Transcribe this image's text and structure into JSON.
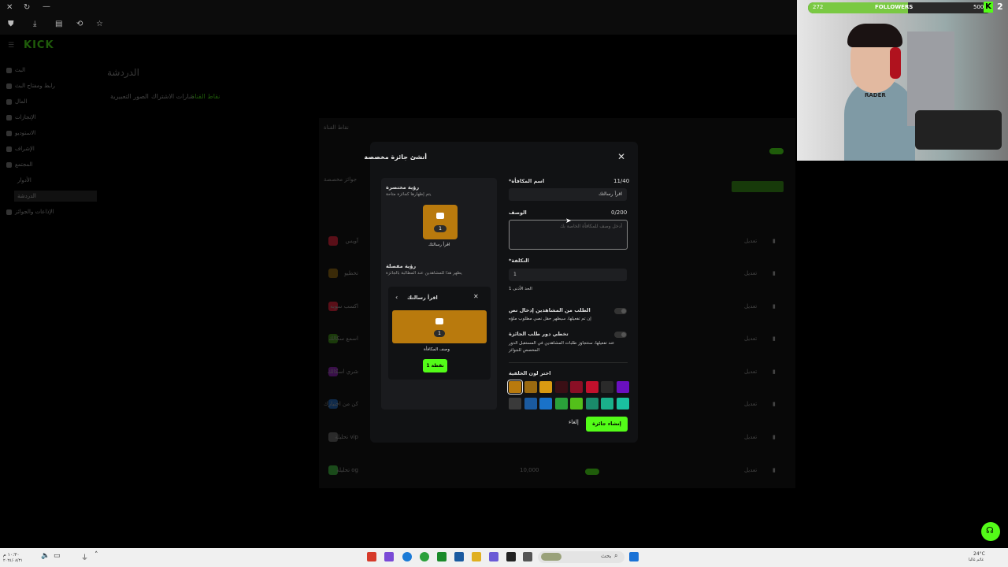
{
  "browser": {
    "nav_icons": [
      "close-icon",
      "reload-icon",
      "minimize-icon"
    ],
    "toolbar_icons": [
      "shield-icon",
      "download-icon",
      "sidebar-icon",
      "translate-icon",
      "star-icon"
    ]
  },
  "site": {
    "logo": "KICK",
    "logo_color": "#53fc18"
  },
  "sidebar": {
    "items": [
      {
        "label": "البث"
      },
      {
        "label": "رابط ومفتاح البث"
      },
      {
        "label": "المال"
      },
      {
        "label": "الإنجازات"
      },
      {
        "label": "الاستوديو"
      },
      {
        "label": "الإشراف"
      },
      {
        "label": "المجتمع"
      },
      {
        "label": "الأدوار"
      },
      {
        "label": "الدردشة"
      },
      {
        "label": "الإذاعات والجوائز"
      }
    ]
  },
  "main": {
    "title": "الدردشة",
    "tabs": [
      "نقاط القناة",
      "شارات الاشتراك",
      "الصور التعبيرية"
    ],
    "bg_section_title": "نقاط القناة",
    "bg_custom_title": "جوائز مخصصة",
    "bg_rows": [
      {
        "name": "آويس",
        "edit": "تعديل"
      },
      {
        "name": "تخطيو",
        "edit": "تعديل"
      },
      {
        "name": "اكسب سوبه",
        "edit": "تعديل"
      },
      {
        "name": "اسمع سكالك",
        "edit": "تعديل"
      },
      {
        "name": "شري اسكالك",
        "edit": "تعديل"
      },
      {
        "name": "كن من اختيارك",
        "edit": "تعديل"
      },
      {
        "name": "تحليلة vip",
        "edit": "تعديل"
      },
      {
        "name": "تحليلة og",
        "edit": "تعديل",
        "value": "10,000"
      }
    ]
  },
  "modal": {
    "title": "أنشئ جائزة مخصصة",
    "close": "✕",
    "preview_short_title": "رؤية مختصرة",
    "preview_short_sub": "يتم إظهارها كجائزة متاحة",
    "reward_count": "1",
    "reward_name": "اقرأ رسالتك",
    "preview_full_title": "رؤية مفصلة",
    "preview_full_sub": "يظهر هذا للمشاهدين عند المطالبة بالجائزة",
    "card_title": "اقرأ رسالتك",
    "card_desc": "وصف المكافأة",
    "redeem_label": "1 نقطة",
    "name_label": "*اسم المكافأة",
    "name_count": "11/40",
    "name_value": "اقرأ رسالتك",
    "desc_label": "الوصف",
    "desc_count": "0/200",
    "desc_placeholder": "أدخل وصف للمكافأة الخاصة بك",
    "cost_label": "*التكلفة",
    "cost_value": "1",
    "cost_min": "الحد الأدنى 1",
    "req_input_title": "الطلب من المشاهدين إدخال نص",
    "req_input_sub": "إن تم تفعيلها، سيظهر حقل نصي مطلوب ملؤه",
    "skip_queue_title": "تخطي دور طلب الجائزة",
    "skip_queue_sub": "عند تفعيلها، ستتجاوز طلبات المشاهدين في المستقبل الدور المخصص للجوائز",
    "color_label": "اختر لون الخلفية",
    "colors_row1": [
      "#b97a0d",
      "#9b6a10",
      "#d99a12",
      "#3a0f15",
      "#8a0f25",
      "#c2102c",
      "#2a2a2a",
      "#6a10c0"
    ],
    "colors_row2": [
      "#3a3a3a",
      "#1a5aa0",
      "#1a72c8",
      "#2aa03a",
      "#53c01a",
      "#1a8a6a",
      "#1ab08a",
      "#1ac0a0"
    ],
    "cancel_label": "إلغاء",
    "create_label": "إنشاء جائزة"
  },
  "overlay": {
    "followers_label": "FOLLOWERS",
    "followers_current": "272",
    "followers_goal": "500",
    "followers_progress": 0.544,
    "headset_text": "RADER",
    "kick_badge": "K",
    "kick_number": "2"
  },
  "taskbar": {
    "time": "١٠:٣٠ م",
    "date": "٢٠٢٤/٠٨/٣١",
    "search_label": "بحث",
    "weather": "24°C",
    "weather_sub": "غائم غالبا"
  }
}
